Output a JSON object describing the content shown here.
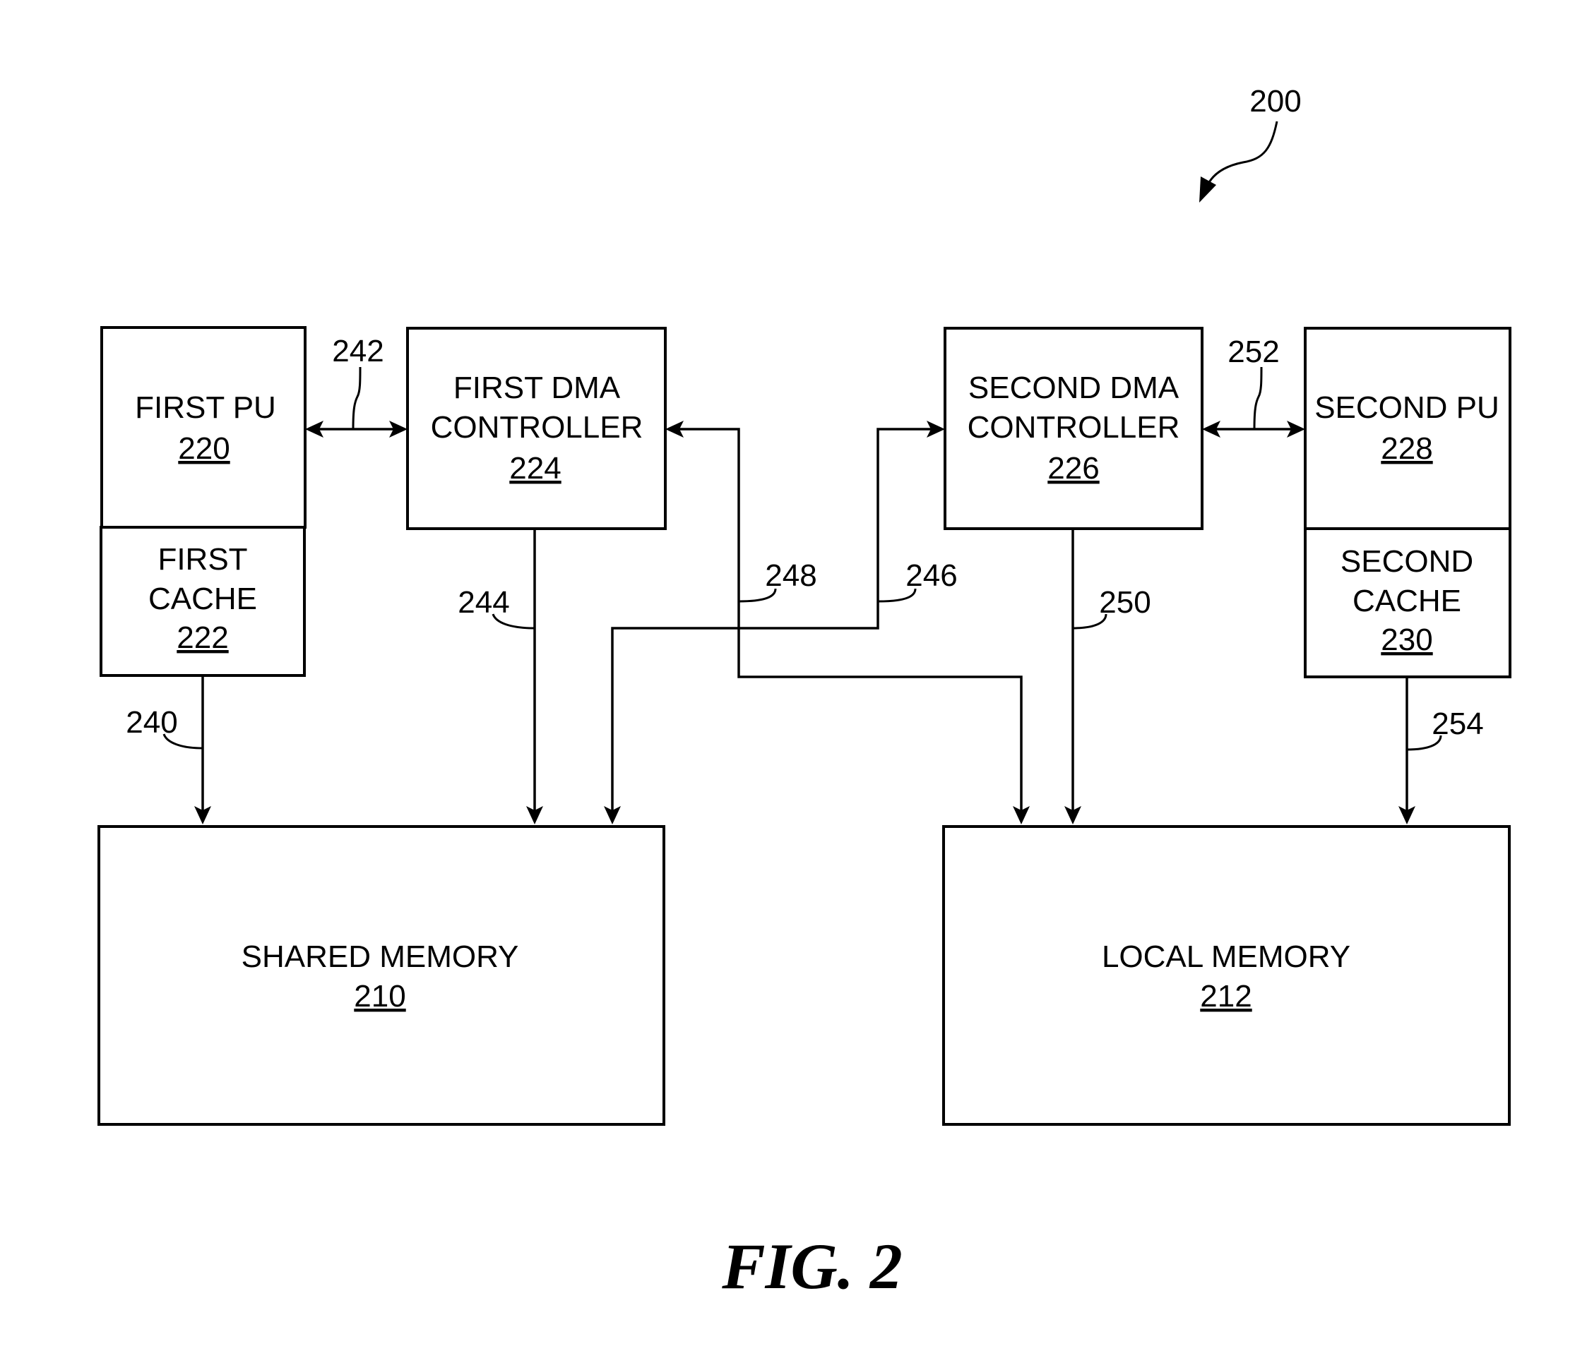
{
  "figure": {
    "caption": "FIG. 2",
    "reference_number": "200"
  },
  "blocks": {
    "first_pu": {
      "label": "FIRST PU",
      "ref": "220"
    },
    "first_cache": {
      "line1": "FIRST",
      "line2": "CACHE",
      "ref": "222"
    },
    "first_dma": {
      "line1": "FIRST DMA",
      "line2": "CONTROLLER",
      "ref": "224"
    },
    "second_dma": {
      "line1": "SECOND DMA",
      "line2": "CONTROLLER",
      "ref": "226"
    },
    "second_pu": {
      "label": "SECOND PU",
      "ref": "228"
    },
    "second_cache": {
      "line1": "SECOND",
      "line2": "CACHE",
      "ref": "230"
    },
    "shared_memory": {
      "label": "SHARED MEMORY",
      "ref": "210"
    },
    "local_memory": {
      "label": "LOCAL MEMORY",
      "ref": "212"
    }
  },
  "connections": {
    "c240": "240",
    "c242": "242",
    "c244": "244",
    "c246": "246",
    "c248": "248",
    "c250": "250",
    "c252": "252",
    "c254": "254"
  }
}
